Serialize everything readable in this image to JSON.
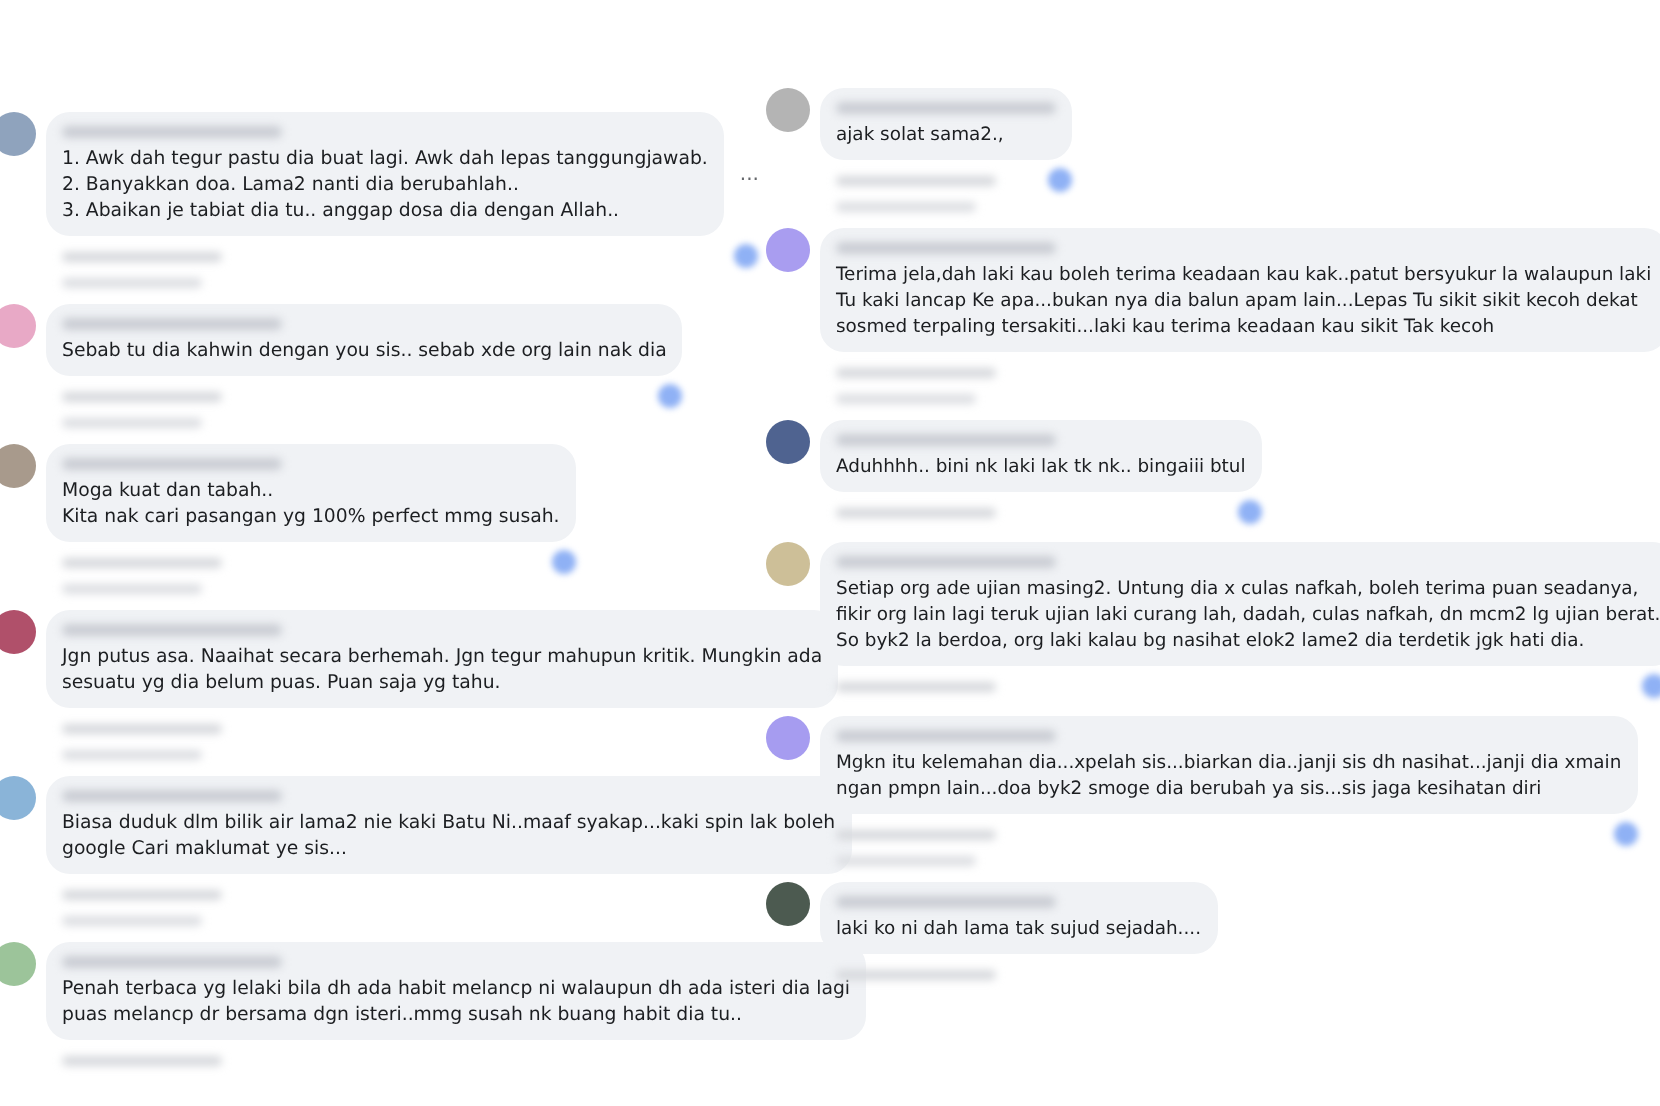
{
  "columns": [
    {
      "comments": [
        {
          "color": "#8fa3bd",
          "text": "1. Awk dah tegur pastu dia buat lagi. Awk dah lepas tanggungjawab.\n2. Banyakkan doa. Lama2 nanti dia berubahlah..\n3. Abaikan je tabiat dia tu.. anggap dosa dia dengan Allah..",
          "more": "...",
          "reaction": true,
          "replies": true
        },
        {
          "color": "#e8a9c6",
          "text": "Sebab tu dia kahwin dengan you sis.. sebab xde org lain nak dia",
          "reaction": true,
          "replies": true
        },
        {
          "color": "#a89a8c",
          "text": "Moga kuat dan tabah..\nKita nak cari pasangan yg 100% perfect mmg susah.",
          "reaction": true,
          "replies": true
        },
        {
          "color": "#b0506a",
          "text": "Jgn putus asa. Naaihat secara berhemah. Jgn tegur mahupun kritik. Mungkin ada\nsesuatu yg dia belum puas. Puan saja yg tahu.",
          "reaction": false,
          "replies": true
        },
        {
          "color": "#8ab4d8",
          "text": "Biasa duduk dlm bilik air lama2 nie kaki Batu Ni..maaf syakap...kaki spin lak boleh\ngoogle Cari maklumat ye sis...",
          "reaction": false,
          "replies": true
        },
        {
          "color": "#9cc49a",
          "text": "Penah terbaca yg lelaki bila dh ada habit melancp ni walaupun dh ada isteri dia lagi\npuas melancp dr bersama dgn isteri..mmg susah nk buang habit dia tu..",
          "reaction": false,
          "replies": false
        }
      ]
    },
    {
      "comments": [
        {
          "color": "#b4b4b4",
          "text": "ajak solat sama2.,",
          "reaction": true,
          "replies": true
        },
        {
          "color": "#a99df0",
          "text": "Terima jela,dah laki kau boleh terima keadaan kau kak..patut bersyukur la walaupun laki\nTu kaki lancap Ke apa...bukan nya dia balun apam lain...Lepas Tu sikit sikit kecoh dekat\nsosmed terpaling tersakiti...laki kau terima keadaan kau sikit Tak kecoh",
          "reaction": false,
          "replies": true
        },
        {
          "color": "#4f6390",
          "text": "Aduhhhh.. bini nk laki lak tk nk.. bingaiii btul",
          "reaction": true,
          "replies": false
        },
        {
          "color": "#cdbf98",
          "text": "Setiap org ade ujian masing2. Untung dia x culas nafkah, boleh terima puan seadanya,\nfikir org lain lagi teruk ujian laki curang lah, dadah, culas nafkah, dn mcm2 lg ujian berat.\nSo byk2 la berdoa, org laki kalau bg nasihat elok2 lame2 dia terdetik jgk hati dia.",
          "reaction": true,
          "replies": false
        },
        {
          "color": "#a69cf0",
          "text": "Mgkn itu kelemahan dia...xpelah sis...biarkan dia..janji sis dh nasihat...janji dia xmain\nngan pmpn lain...doa byk2 smoge dia berubah ya sis...sis jaga kesihatan diri",
          "reaction": true,
          "replies": true
        },
        {
          "color": "#4c5a50",
          "text": "laki ko ni dah lama tak sujud sejadah....",
          "reaction": false,
          "replies": false
        }
      ]
    }
  ]
}
